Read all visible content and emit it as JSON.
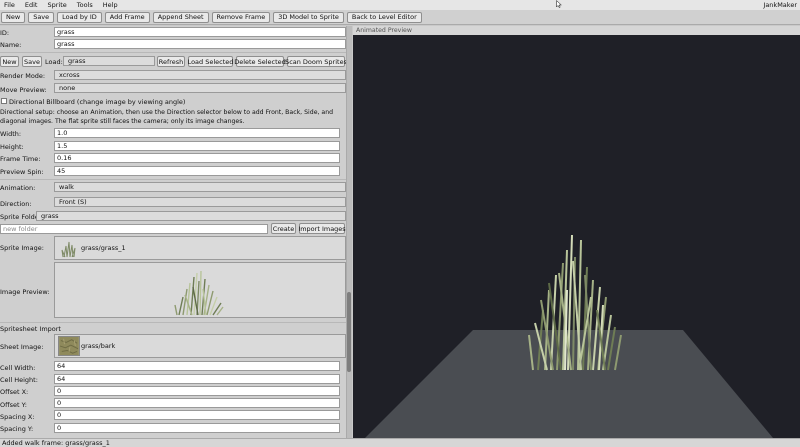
{
  "menu": [
    "File",
    "Edit",
    "Sprite",
    "Tools",
    "Help"
  ],
  "app_title": "JankMaker",
  "toolbar": [
    "New",
    "Save",
    "Load by ID",
    "Add Frame",
    "Append Sheet",
    "Remove Frame",
    "3D Model to Sprite",
    "Back to Level Editor"
  ],
  "form": {
    "id_label": "ID:",
    "id_value": "grass",
    "name_label": "Name:",
    "name_value": "grass",
    "new_btn": "New",
    "save_btn": "Save",
    "load_label": "Load:",
    "load_value": "grass",
    "refresh_btn": "Refresh",
    "load_selected_btn": "Load Selected",
    "delete_selected_btn": "Delete Selected",
    "scan_btn": "Scan Doom Sprites",
    "render_mode_label": "Render Mode:",
    "render_mode_value": "xcross",
    "move_preview_label": "Move Preview:",
    "move_preview_value": "none",
    "billboard_label": "Directional Billboard (change image by viewing angle)",
    "billboard_checked": false,
    "note": "Directional setup: choose an Animation, then use the Direction selector below to add Front, Back, Side, and diagonal images. The flat sprite still faces the camera; only its image changes.",
    "width_label": "Width:",
    "width_value": "1.0",
    "height_label": "Height:",
    "height_value": "1.5",
    "frame_time_label": "Frame Time:",
    "frame_time_value": "0.16",
    "preview_spin_label": "Preview Spin:",
    "preview_spin_value": "45",
    "animation_label": "Animation:",
    "animation_value": "walk",
    "direction_label": "Direction:",
    "direction_value": "Front (S)",
    "sprite_folder_label": "Sprite Folder:",
    "sprite_folder_value": "grass",
    "new_folder_placeholder": "new folder",
    "create_btn": "Create",
    "import_images_btn": "Import Images",
    "sprite_image_label": "Sprite Image:",
    "sprite_image_value": "grass/grass_1",
    "image_preview_label": "Image Preview:",
    "spritesheet_header": "Spritesheet Import",
    "sheet_image_label": "Sheet Image:",
    "sheet_image_value": "grass/bark",
    "cell_width_label": "Cell Width:",
    "cell_width_value": "64",
    "cell_height_label": "Cell Height:",
    "cell_height_value": "64",
    "offset_x_label": "Offset X:",
    "offset_x_value": "0",
    "offset_y_label": "Offset Y:",
    "offset_y_value": "0",
    "spacing_x_label": "Spacing X:",
    "spacing_x_value": "0",
    "spacing_y_label": "Spacing Y:",
    "spacing_y_value": "0"
  },
  "preview": {
    "title": "Animated Preview"
  },
  "status": "Added walk frame: grass/grass_1",
  "colors": {
    "viewport_bg": "#1f2027",
    "floor": "#4a4d52",
    "grass_light": "#b8c49a",
    "grass_dark": "#6f7d55"
  },
  "icons": [
    "cursor-icon",
    "checkbox-icon",
    "grass-thumbnail-icon",
    "bark-thumbnail-icon"
  ]
}
